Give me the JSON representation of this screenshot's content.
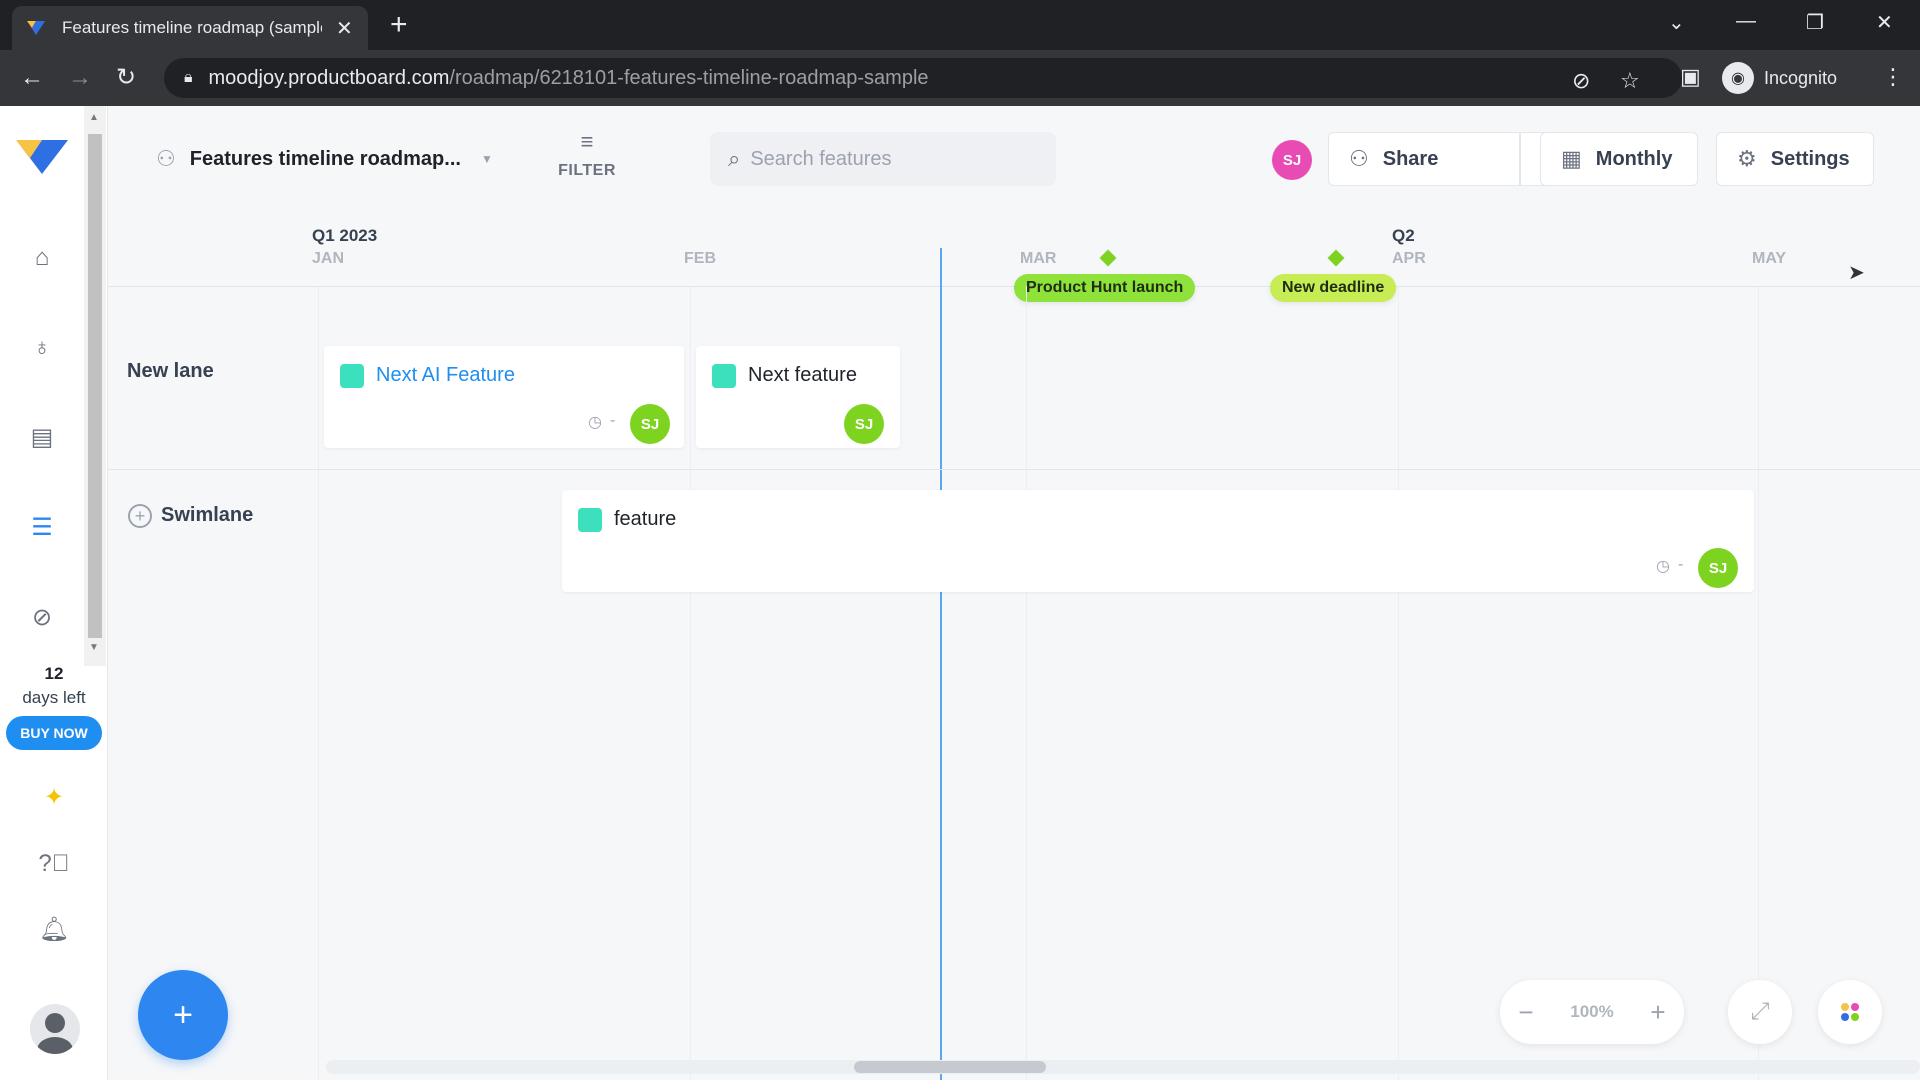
{
  "browser": {
    "tab_title": "Features timeline roadmap (sample)",
    "url_host": "moodjoy.productboard.com",
    "url_path": "/roadmap/6218101-features-timeline-roadmap-sample",
    "incognito_label": "Incognito"
  },
  "rail": {
    "trial_days": "12",
    "trial_text": "days left",
    "buy_now_label": "BUY NOW",
    "icons": [
      "home-icon",
      "lightbulb-icon",
      "notes-icon",
      "roadmap-icon",
      "objectives-icon",
      "sparkles-icon",
      "help-icon",
      "bell-icon"
    ]
  },
  "toolbar": {
    "roadmap_name": "Features timeline roadmap...",
    "filter_label": "FILTER",
    "search_placeholder": "Search features",
    "user_initials": "SJ",
    "share_label": "Share",
    "monthly_label": "Monthly",
    "settings_label": "Settings"
  },
  "timeline": {
    "quarters": [
      "Q1 2023",
      "Q2"
    ],
    "months": [
      "JAN",
      "FEB",
      "MAR",
      "APR",
      "MAY"
    ],
    "milestones": [
      "Product Hunt launch",
      "New deadline"
    ]
  },
  "lanes": [
    {
      "name": "New lane",
      "cards": [
        {
          "title": "Next AI Feature",
          "timeframe": "-",
          "owner": "SJ"
        },
        {
          "title": "Next feature",
          "owner": "SJ"
        }
      ]
    },
    {
      "name": "Swimlane",
      "cards": [
        {
          "title": "feature",
          "timeframe": "-",
          "owner": "SJ"
        }
      ]
    }
  ],
  "zoom": {
    "value": "100%"
  },
  "colors": {
    "accent": "#2e86f0",
    "milestone_green": "#8ee23a",
    "milestone_yellow": "#c8ec54",
    "card_square": "#3de0bd",
    "avatar_green": "#7ed321",
    "avatar_pink": "#e84bb4"
  }
}
